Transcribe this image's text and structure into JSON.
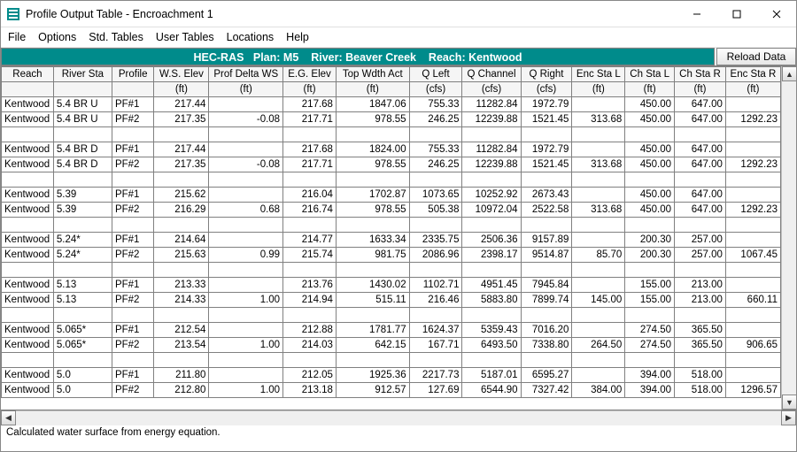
{
  "window": {
    "title": "Profile Output Table - Encroachment 1"
  },
  "menu": {
    "items": [
      "File",
      "Options",
      "Std. Tables",
      "User Tables",
      "Locations",
      "Help"
    ]
  },
  "banner": {
    "label": "HEC-RAS",
    "plan": "Plan: M5",
    "river": "River: Beaver Creek",
    "reach": "Reach: Kentwood"
  },
  "buttons": {
    "reload": "Reload Data"
  },
  "status": {
    "text": "Calculated water surface from energy equation."
  },
  "columns": {
    "labels": [
      "Reach",
      "River Sta",
      "Profile",
      "W.S. Elev",
      "Prof Delta WS",
      "E.G. Elev",
      "Top Wdth Act",
      "Q Left",
      "Q Channel",
      "Q Right",
      "Enc Sta L",
      "Ch Sta L",
      "Ch Sta R",
      "Enc Sta R"
    ],
    "units": [
      "",
      "",
      "",
      "(ft)",
      "(ft)",
      "(ft)",
      "(ft)",
      "(cfs)",
      "(cfs)",
      "(cfs)",
      "(ft)",
      "(ft)",
      "(ft)",
      "(ft)"
    ]
  },
  "rows": [
    {
      "reach": "Kentwood",
      "sta": "5.4     BR U",
      "prof": "PF#1",
      "wse": "217.44",
      "pdws": "",
      "ege": "217.68",
      "twa": "1847.06",
      "ql": "755.33",
      "qc": "11282.84",
      "qr": "1972.79",
      "esl": "",
      "csl": "450.00",
      "csr": "647.00",
      "esr": ""
    },
    {
      "reach": "Kentwood",
      "sta": "5.4     BR U",
      "prof": "PF#2",
      "wse": "217.35",
      "pdws": "-0.08",
      "ege": "217.71",
      "twa": "978.55",
      "ql": "246.25",
      "qc": "12239.88",
      "qr": "1521.45",
      "esl": "313.68",
      "csl": "450.00",
      "csr": "647.00",
      "esr": "1292.23"
    },
    {
      "sep": true
    },
    {
      "reach": "Kentwood",
      "sta": "5.4     BR D",
      "prof": "PF#1",
      "wse": "217.44",
      "pdws": "",
      "ege": "217.68",
      "twa": "1824.00",
      "ql": "755.33",
      "qc": "11282.84",
      "qr": "1972.79",
      "esl": "",
      "csl": "450.00",
      "csr": "647.00",
      "esr": ""
    },
    {
      "reach": "Kentwood",
      "sta": "5.4     BR D",
      "prof": "PF#2",
      "wse": "217.35",
      "pdws": "-0.08",
      "ege": "217.71",
      "twa": "978.55",
      "ql": "246.25",
      "qc": "12239.88",
      "qr": "1521.45",
      "esl": "313.68",
      "csl": "450.00",
      "csr": "647.00",
      "esr": "1292.23"
    },
    {
      "sep": true
    },
    {
      "reach": "Kentwood",
      "sta": "5.39",
      "prof": "PF#1",
      "wse": "215.62",
      "pdws": "",
      "ege": "216.04",
      "twa": "1702.87",
      "ql": "1073.65",
      "qc": "10252.92",
      "qr": "2673.43",
      "esl": "",
      "csl": "450.00",
      "csr": "647.00",
      "esr": ""
    },
    {
      "reach": "Kentwood",
      "sta": "5.39",
      "prof": "PF#2",
      "wse": "216.29",
      "pdws": "0.68",
      "ege": "216.74",
      "twa": "978.55",
      "ql": "505.38",
      "qc": "10972.04",
      "qr": "2522.58",
      "esl": "313.68",
      "csl": "450.00",
      "csr": "647.00",
      "esr": "1292.23"
    },
    {
      "sep": true
    },
    {
      "reach": "Kentwood",
      "sta": "5.24*",
      "prof": "PF#1",
      "wse": "214.64",
      "pdws": "",
      "ege": "214.77",
      "twa": "1633.34",
      "ql": "2335.75",
      "qc": "2506.36",
      "qr": "9157.89",
      "esl": "",
      "csl": "200.30",
      "csr": "257.00",
      "esr": ""
    },
    {
      "reach": "Kentwood",
      "sta": "5.24*",
      "prof": "PF#2",
      "wse": "215.63",
      "pdws": "0.99",
      "ege": "215.74",
      "twa": "981.75",
      "ql": "2086.96",
      "qc": "2398.17",
      "qr": "9514.87",
      "esl": "85.70",
      "csl": "200.30",
      "csr": "257.00",
      "esr": "1067.45"
    },
    {
      "sep": true
    },
    {
      "reach": "Kentwood",
      "sta": "5.13",
      "prof": "PF#1",
      "wse": "213.33",
      "pdws": "",
      "ege": "213.76",
      "twa": "1430.02",
      "ql": "1102.71",
      "qc": "4951.45",
      "qr": "7945.84",
      "esl": "",
      "csl": "155.00",
      "csr": "213.00",
      "esr": ""
    },
    {
      "reach": "Kentwood",
      "sta": "5.13",
      "prof": "PF#2",
      "wse": "214.33",
      "pdws": "1.00",
      "ege": "214.94",
      "twa": "515.11",
      "ql": "216.46",
      "qc": "5883.80",
      "qr": "7899.74",
      "esl": "145.00",
      "csl": "155.00",
      "csr": "213.00",
      "esr": "660.11"
    },
    {
      "sep": true
    },
    {
      "reach": "Kentwood",
      "sta": "5.065*",
      "prof": "PF#1",
      "wse": "212.54",
      "pdws": "",
      "ege": "212.88",
      "twa": "1781.77",
      "ql": "1624.37",
      "qc": "5359.43",
      "qr": "7016.20",
      "esl": "",
      "csl": "274.50",
      "csr": "365.50",
      "esr": ""
    },
    {
      "reach": "Kentwood",
      "sta": "5.065*",
      "prof": "PF#2",
      "wse": "213.54",
      "pdws": "1.00",
      "ege": "214.03",
      "twa": "642.15",
      "ql": "167.71",
      "qc": "6493.50",
      "qr": "7338.80",
      "esl": "264.50",
      "csl": "274.50",
      "csr": "365.50",
      "esr": "906.65"
    },
    {
      "sep": true
    },
    {
      "reach": "Kentwood",
      "sta": "5.0",
      "prof": "PF#1",
      "wse": "211.80",
      "pdws": "",
      "ege": "212.05",
      "twa": "1925.36",
      "ql": "2217.73",
      "qc": "5187.01",
      "qr": "6595.27",
      "esl": "",
      "csl": "394.00",
      "csr": "518.00",
      "esr": ""
    },
    {
      "reach": "Kentwood",
      "sta": "5.0",
      "prof": "PF#2",
      "wse": "212.80",
      "pdws": "1.00",
      "ege": "213.18",
      "twa": "912.57",
      "ql": "127.69",
      "qc": "6544.90",
      "qr": "7327.42",
      "esl": "384.00",
      "csl": "394.00",
      "csr": "518.00",
      "esr": "1296.57"
    }
  ]
}
